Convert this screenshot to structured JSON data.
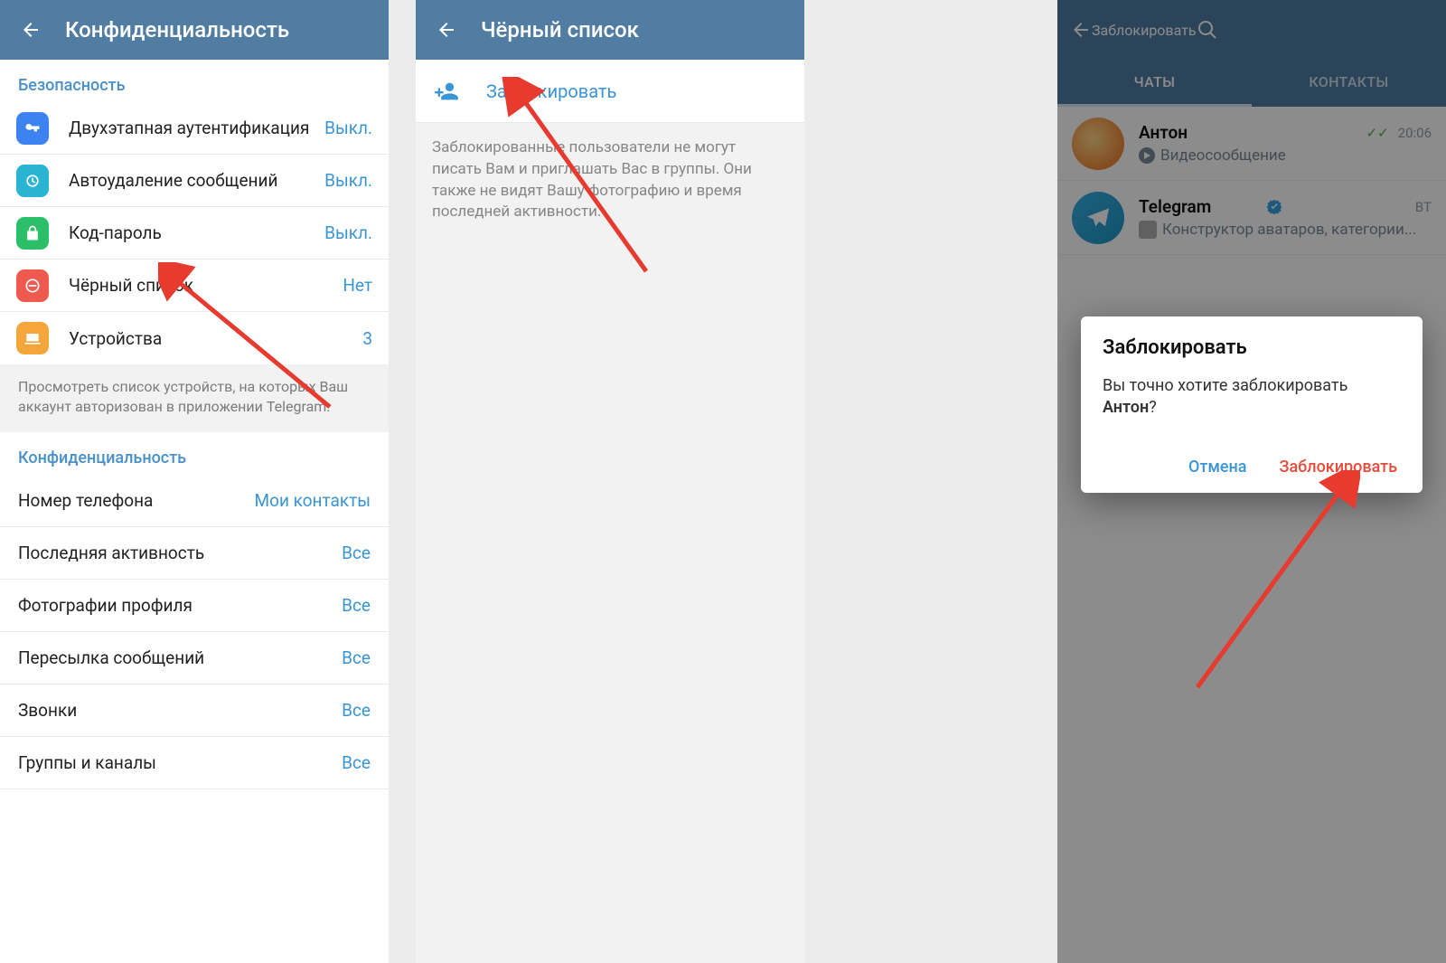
{
  "phone1": {
    "toolbar_title": "Конфиденциальность",
    "section_security": "Безопасность",
    "security_rows": [
      {
        "label": "Двухэтапная аутентификация",
        "value": "Выкл.",
        "icon": "ic-blue",
        "name": "row-two-step"
      },
      {
        "label": "Автоудаление сообщений",
        "value": "Выкл.",
        "icon": "ic-cyan",
        "name": "row-autodelete"
      },
      {
        "label": "Код-пароль",
        "value": "Выкл.",
        "icon": "ic-green",
        "name": "row-passcode"
      },
      {
        "label": "Чёрный список",
        "value": "Нет",
        "icon": "ic-red",
        "name": "row-blacklist"
      },
      {
        "label": "Устройства",
        "value": "3",
        "icon": "ic-orange",
        "name": "row-devices"
      }
    ],
    "devices_info": "Просмотреть список устройств, на которых Ваш аккаунт авторизован в приложении Telegram.",
    "section_privacy": "Конфиденциальность",
    "privacy_rows": [
      {
        "label": "Номер телефона",
        "value": "Мои контакты",
        "name": "row-phone"
      },
      {
        "label": "Последняя активность",
        "value": "Все",
        "name": "row-lastseen"
      },
      {
        "label": "Фотографии профиля",
        "value": "Все",
        "name": "row-profile-photos"
      },
      {
        "label": "Пересылка сообщений",
        "value": "Все",
        "name": "row-forwarding"
      },
      {
        "label": "Звонки",
        "value": "Все",
        "name": "row-calls"
      },
      {
        "label": "Группы и каналы",
        "value": "Все",
        "name": "row-groups"
      }
    ]
  },
  "phone2": {
    "toolbar_title": "Чёрный список",
    "block_label": "Заблокировать",
    "description": "Заблокированные пользователи не могут писать Вам и приглашать Вас в группы. Они также не видят Вашу фотографию и время последней активности."
  },
  "phone3": {
    "toolbar_title": "Заблокировать",
    "tabs": {
      "chats": "ЧАТЫ",
      "contacts": "КОНТАКТЫ"
    },
    "chats": [
      {
        "name": "Антон",
        "sub": "Видеосообщение",
        "time": "20:06",
        "checks": true,
        "verified": false,
        "avatar": "orange",
        "has_video_icon": true
      },
      {
        "name": "Telegram",
        "sub": "Конструктор аватаров, категории...",
        "time": "ВТ",
        "checks": false,
        "verified": true,
        "avatar": "tg",
        "has_thumb": true
      }
    ],
    "dialog": {
      "title": "Заблокировать",
      "text_prefix": "Вы точно хотите заблокировать ",
      "text_name": "Антон",
      "text_suffix": "?",
      "cancel": "Отмена",
      "confirm": "Заблокировать"
    }
  }
}
